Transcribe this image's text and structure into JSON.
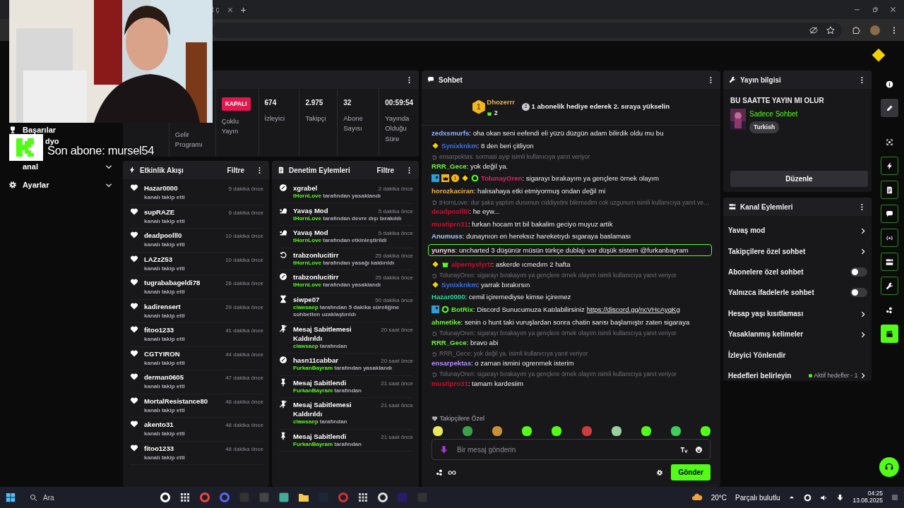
{
  "browser": {
    "tab_title": "t ç",
    "new_tab": "+"
  },
  "overlay": {
    "text": "Son abone: mursel54"
  },
  "sidebar": {
    "items": [
      {
        "label": "Başarılar",
        "expandable": false
      },
      {
        "label": "dyo",
        "expandable": false
      },
      {
        "label": "anal",
        "expandable": true
      },
      {
        "label": "Ayarlar",
        "expandable": true
      }
    ]
  },
  "stats": [
    {
      "kind": "blank"
    },
    {
      "kind": "text",
      "label": "Gelir Programı"
    },
    {
      "kind": "status",
      "value": "KAPALI",
      "label": "Çoklu Yayın"
    },
    {
      "kind": "number",
      "value": "674",
      "label": "İzleyici"
    },
    {
      "kind": "number",
      "value": "2.975",
      "label": "Takipçi"
    },
    {
      "kind": "number",
      "value": "32",
      "label": "Abone Sayısı"
    },
    {
      "kind": "number",
      "value": "00:59:54",
      "label": "Yayında Olduğu Süre"
    }
  ],
  "activity": {
    "title": "Etkinlik Akışı",
    "filter": "Filtre",
    "items": [
      {
        "user": "Hazar0000",
        "action": "kanalı takip etti",
        "time": "5 dakika önce"
      },
      {
        "user": "supRAZE",
        "action": "kanalı takip etti",
        "time": "6 dakika önce"
      },
      {
        "user": "deadpoolll0",
        "action": "kanalı takip etti",
        "time": "10 dakika önce"
      },
      {
        "user": "LAZzZ53",
        "action": "kanalı takip etti",
        "time": "10 dakika önce"
      },
      {
        "user": "tugrababageldi78",
        "action": "kanalı takip etti",
        "time": "26 dakika önce"
      },
      {
        "user": "kadirensert",
        "action": "kanalı takip etti",
        "time": "29 dakika önce"
      },
      {
        "user": "fitoo1233",
        "action": "kanalı takip etti",
        "time": "41 dakika önce"
      },
      {
        "user": "CGTYIRON",
        "action": "kanalı takip etti",
        "time": "44 dakika önce"
      },
      {
        "user": "derman0605",
        "action": "kanalı takip etti",
        "time": "47 dakika önce"
      },
      {
        "user": "MortalResistance80",
        "action": "kanalı takip etti",
        "time": "48 dakika önce"
      },
      {
        "user": "akento31",
        "action": "kanalı takip etti",
        "time": "48 dakika önce"
      },
      {
        "user": "fitoo1233",
        "action": "kanalı takip etti",
        "time": "48 dakika önce"
      }
    ]
  },
  "moderation": {
    "title": "Denetim Eylemleri",
    "filter": "Filtre",
    "items": [
      {
        "kind": "ban",
        "title": "xgrabel",
        "actor": "tHornLove",
        "action": "tarafından yasaklandı",
        "time": "2 dakika önce"
      },
      {
        "kind": "slow",
        "title": "Yavaş Mod",
        "actor": "tHornLove",
        "action": "tarafından devre dışı bırakıldı",
        "time": "5 dakika önce"
      },
      {
        "kind": "slow",
        "title": "Yavaş Mod",
        "actor": "tHornLove",
        "action": "tarafından etkinleştirildi",
        "time": "5 dakika önce"
      },
      {
        "kind": "unban",
        "title": "trabzonlucitirr",
        "actor": "tHornLove",
        "action": "tarafından yasağı kaldırıldı",
        "time": "25 dakika önce"
      },
      {
        "kind": "ban",
        "title": "trabzonlucitirr",
        "actor": "tHornLove",
        "action": "tarafından yasaklandı",
        "time": "25 dakika önce"
      },
      {
        "kind": "timeout",
        "title": "siwpe07",
        "actor": "clawsaep",
        "action": "tarafından 5 dakika süreliğine sohbetten uzaklaştırıldı",
        "time": "50 dakika önce"
      },
      {
        "kind": "unpin",
        "title": "Mesaj Sabitlemesi Kaldırıldı",
        "actor": "clawsaep",
        "action": "tarafından",
        "time": "20 saat önce"
      },
      {
        "kind": "ban",
        "title": "hasn11cabbar",
        "actor": "FurkanBayram",
        "action": "tarafından yasaklandı",
        "time": "20 saat önce"
      },
      {
        "kind": "pin",
        "title": "Mesaj Sabitlendi",
        "actor": "FurkanBayram",
        "action": "tarafından",
        "time": "21 saat önce"
      },
      {
        "kind": "unpin",
        "title": "Mesaj Sabitlemesi Kaldırıldı",
        "actor": "clawsaep",
        "action": "tarafından",
        "time": "21 saat önce"
      },
      {
        "kind": "pin",
        "title": "Mesaj Sabitlendi",
        "actor": "FurkanBayram",
        "action": "tarafından",
        "time": "21 saat önce"
      }
    ]
  },
  "chat": {
    "title": "Sohbet",
    "leader": {
      "rank": "1",
      "user": "Dhozerrr",
      "gifts": "2",
      "next_rank": "2",
      "hint": "1 abonelik hediye ederek 2. sıraya yükselin"
    },
    "messages": [
      {
        "user": "zedxsmurfs",
        "color": "#8fb0ff",
        "text": ": oha okan seni eefendi eli yüzü düzgün adam bilirdik oldu mu bu",
        "highlighted": false
      },
      {
        "badges": [
          {
            "kind": "og"
          }
        ],
        "user": "Synixknkm",
        "color": "#3f6fe0",
        "text": ": 8 den beri çitliyon",
        "highlighted": false
      },
      {
        "reply": "ensarpektas: sormasi ayip isimli kullanıcıya yanıt veriyor",
        "user": "RRR_Gece",
        "color": "#72f03a",
        "text": ": yok değil ya.",
        "highlighted": false
      },
      {
        "badges": [
          {
            "kind": "mod"
          },
          {
            "kind": "vip"
          },
          {
            "kind": "sub",
            "label": "1"
          },
          {
            "kind": "og"
          },
          {
            "kind": "verified"
          }
        ],
        "user": "TolunayOren",
        "color": "#e0245e",
        "text": ": sigarayı bırakayım ya gençlere örnek olayım",
        "highlighted": false
      },
      {
        "user": "horozkaciran",
        "color": "#e8b04a",
        "text": ": halısahaya etki etmiyormuş ondan değil mi",
        "highlighted": false
      },
      {
        "reply": "tHornLove: dur şaka yaptım durumun ciddiyetini bilemedim cok uzgunum isimli kullanıcıya yanıt ve…",
        "user": "deadpoolll0",
        "color": "#c8102e",
        "text": ": he eyw...",
        "highlighted": false
      },
      {
        "user": "mustipro31",
        "color": "#c8102e",
        "text": ": furkan hocam trt bil bakalim geciyo muyuz artik",
        "highlighted": false
      },
      {
        "user": "Anumuss",
        "color": "#a9c8ff",
        "text": ": dunaynıon en hereksız hareketıydı sıgaraya baslaması",
        "highlighted": false
      },
      {
        "user": "yunyns",
        "color": "#f2d4dc",
        "text": ": uncharted 3 düşünür müsün türkçe dublajı var düşük sistem @furkanbayram",
        "highlighted": true
      },
      {
        "badges": [
          {
            "kind": "og"
          },
          {
            "kind": "gift"
          }
        ],
        "user": "alpernyslyrtt",
        "color": "#c8102e",
        "text": ": askerde ıcmedım 2 hafta",
        "highlighted": false
      },
      {
        "reply": "TolunayOren: sigarayı bırakayım ya gençlere örnek olayım isimli kullanıcıya yanıt veriyor",
        "badges": [
          {
            "kind": "og"
          }
        ],
        "user": "Synixknkm",
        "color": "#3f6fe0",
        "text": ": yarrak bırakırsın",
        "highlighted": false
      },
      {
        "user": "Hazar0000",
        "color": "#2bd9a0",
        "text": ": cemil içiremediyse kimse içiremez",
        "highlighted": false
      },
      {
        "badges": [
          {
            "kind": "mod"
          },
          {
            "kind": "verified"
          }
        ],
        "user": "BotRix",
        "color": "#53fc18",
        "text": ": Discord Sunucumuza Katılabilirsiniz",
        "link": "https://discord.gg/ncVHcAyqKg",
        "highlighted": false
      },
      {
        "user": "ahmetike",
        "color": "#72f03a",
        "text": ": senin o hunt taki vuruşlardan sonra chatin sarısı başlamıştır zaten sigaraya",
        "highlighted": false
      },
      {
        "reply": "TolunayOren: sigarayı bırakayım ya gençlere örnek olayım isimli kullanıcıya yanıt veriyor",
        "user": "RRR_Gece",
        "color": "#72f03a",
        "text": ": bravo abi",
        "highlighted": false
      },
      {
        "reply": "RRR_Gece: yok değil ya. isimli kullanıcıya yanıt veriyor",
        "user": "ensarpektas",
        "color": "#b58cff",
        "text": ": o zaman ismini ogrenmek isterim",
        "highlighted": false
      },
      {
        "reply": "TolunayOren: sigarayı bırakayım ya gençlere örnek olayım isimli kullanıcıya yanıt veriyor",
        "user": "mustipro31",
        "color": "#c8102e",
        "text": ": tamam kardesiim",
        "highlighted": false
      }
    ],
    "emote_label": "Takipçilere Özel",
    "input": {
      "placeholder": "Bir mesaj gönderin"
    },
    "send": "Gönder"
  },
  "stream_info": {
    "title": "Yayın bilgisi",
    "stream_title": "BU SAATTE YAYIN MI OLUR",
    "category": "Sadece Sohbet",
    "tag": "Turkish",
    "edit": "Düzenle"
  },
  "channel_actions": {
    "title": "Kanal Eylemleri",
    "items": [
      {
        "kind": "link",
        "label": "Yavaş mod"
      },
      {
        "kind": "link",
        "label": "Takipçilere özel sohbet"
      },
      {
        "kind": "toggle",
        "label": "Abonelere özel sohbet",
        "on": false
      },
      {
        "kind": "toggle",
        "label": "Yalnızca ifadelerle sohbet",
        "on": false
      },
      {
        "kind": "link",
        "label": "Hesap yaşı kısıtlaması"
      },
      {
        "kind": "link",
        "label": "Yasaklanmış kelimeler"
      },
      {
        "kind": "plain",
        "label": "İzleyici Yönlendir"
      },
      {
        "kind": "status",
        "label": "Hedefleri belirleyin",
        "status": "Aktif hedefler - 1",
        "color": "#53fc18"
      }
    ]
  },
  "rail": [
    {
      "kind": "info",
      "active": false,
      "selected": false
    },
    {
      "kind": "pencil",
      "active": false,
      "selected": true
    },
    {
      "kind": "capture",
      "active": false,
      "selected": false
    },
    {
      "kind": "bolt",
      "active": true,
      "selected": false
    },
    {
      "kind": "doc",
      "active": true,
      "selected": false
    },
    {
      "kind": "chat",
      "active": true,
      "selected": false
    },
    {
      "kind": "broadcast",
      "active": true,
      "selected": false
    },
    {
      "kind": "channel",
      "active": true,
      "selected": false
    },
    {
      "kind": "wrench",
      "active": true,
      "selected": false
    },
    {
      "kind": "dots",
      "active": false,
      "selected": false
    },
    {
      "kind": "clapper",
      "active": true,
      "selected": false
    }
  ],
  "taskbar": {
    "search": "Ara",
    "temperature": "20°C",
    "weather": "Parçalı bulutlu",
    "time": "04:25",
    "date": "13.08.2025"
  }
}
